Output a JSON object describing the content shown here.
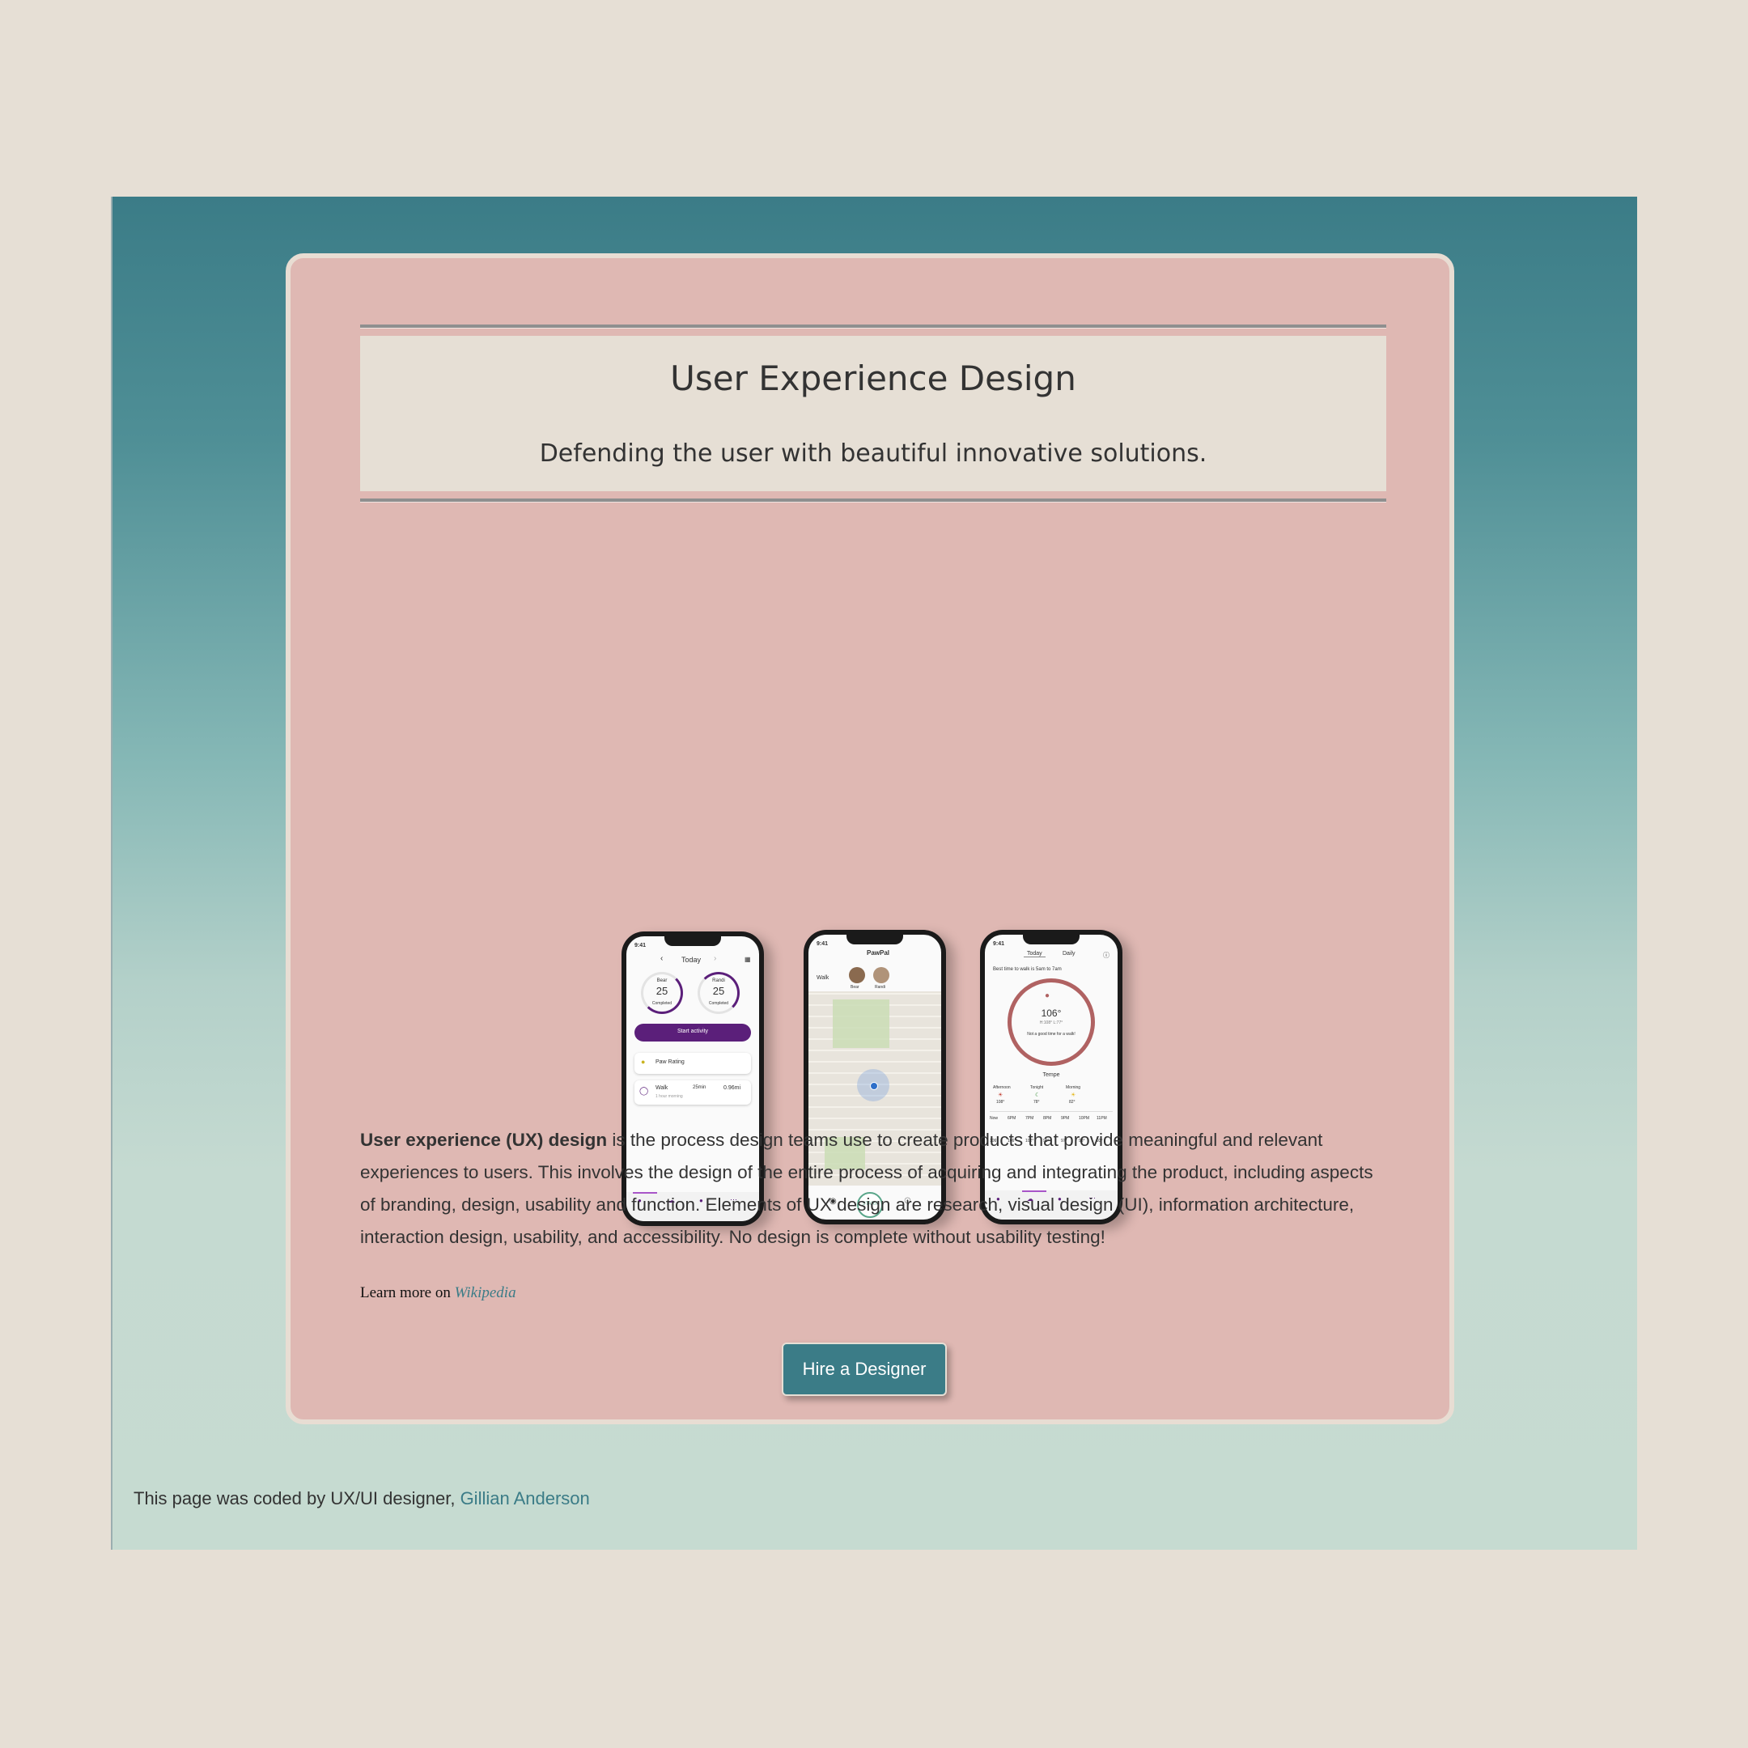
{
  "header": {
    "title": "User Experience Design",
    "subtitle": "Defending the user with beautiful innovative solutions."
  },
  "hero": {
    "phone1": {
      "time": "9:41",
      "nav_label": "Today",
      "ring1_name": "Bear",
      "ring1_value": "25",
      "ring1_unit": "mins",
      "ring1_status": "Completed",
      "ring2_name": "Randi",
      "ring2_value": "25",
      "ring2_unit": "mins",
      "ring2_status": "Completed",
      "cta": "Start activity",
      "card1": "Paw Rating",
      "card2_label": "Walk",
      "card2_sub": "1 hour morning",
      "card2_time": "25min",
      "card2_dist": "0.96mi",
      "tabs": [
        "Activity",
        "Weather",
        "Community",
        "More"
      ]
    },
    "phone2": {
      "time": "9:41",
      "app_name": "PawPal",
      "walk_label": "Walk",
      "dog1": "Bear",
      "dog2": "Randi",
      "start": "START"
    },
    "phone3": {
      "time": "9:41",
      "tab_today": "Today",
      "tab_daily": "Daily",
      "advice": "Best time to walk is 5am to 7am",
      "temp": "106°",
      "hilo": "H:108°   L:77°",
      "warning": "Not a good time for a walk!",
      "city": "Tempe",
      "periods": [
        {
          "label": "Afternoon",
          "temp": "108°"
        },
        {
          "label": "Tonight",
          "temp": "78°"
        },
        {
          "label": "Morning",
          "temp": "82°"
        }
      ],
      "hours": [
        "Now",
        "6PM",
        "7PM",
        "8PM",
        "9PM",
        "10PM",
        "11PM"
      ],
      "hour_temps": [
        "106°",
        "106°",
        "102°",
        "99°",
        "97°",
        "93°",
        "93°"
      ],
      "tabs": [
        "Activity",
        "Weather",
        "Community",
        "More"
      ]
    }
  },
  "body": {
    "lead_bold": "User experience (UX) design",
    "paragraph": " is the process design teams use to create products that provide meaningful and relevant experiences to users. This involves the design of the entire process of acquiring and integrating the product, including aspects of branding, design, usability and function. Elements of UX design are research, visual design (UI), information architecture, interaction design, usability, and accessibility. No design is complete without usability testing!",
    "learn_prefix": "Learn more on ",
    "learn_link": "Wikipedia"
  },
  "cta": {
    "hire_label": "Hire a Designer"
  },
  "footer": {
    "prefix": "This page was coded by UX/UI designer, ",
    "author_link": "Gillian Anderson"
  },
  "colors": {
    "page_bg": "#e6dfd5",
    "teal": "#3b7c87",
    "card_pink": "#dfb8b3",
    "purple": "#5b1f7a",
    "warning_ring": "#b06262"
  }
}
